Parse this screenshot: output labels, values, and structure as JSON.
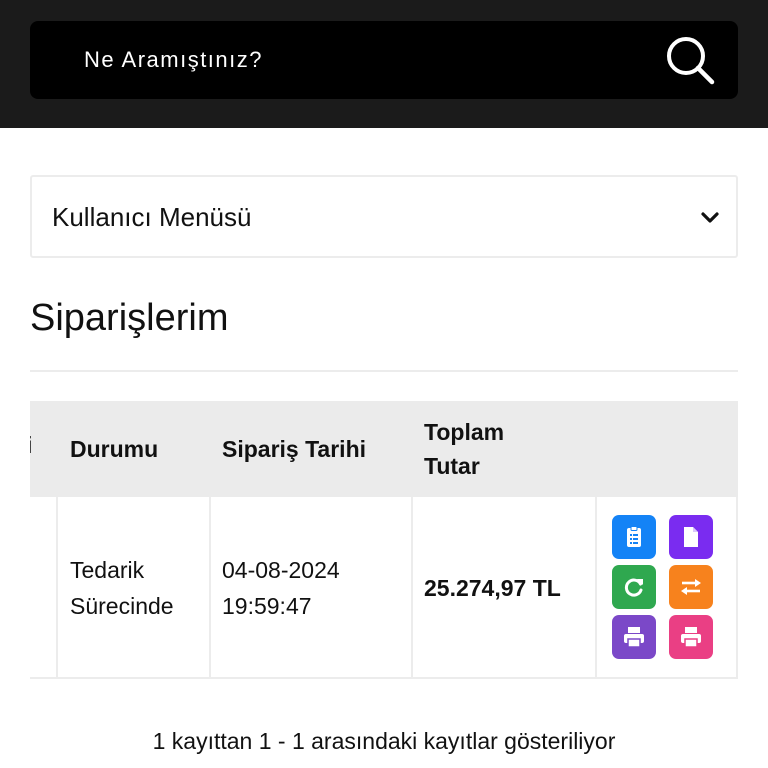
{
  "search": {
    "placeholder": "Ne Aramıştınız?"
  },
  "user_menu": {
    "label": "Kullanıcı Menüsü"
  },
  "page": {
    "title": "Siparişlerim"
  },
  "table": {
    "partial_column": "i",
    "headers": {
      "status": "Durumu",
      "date": "Sipariş Tarihi",
      "total_line1": "Toplam",
      "total_line2": "Tutar"
    },
    "rows": [
      {
        "status_line1": "Tedarik",
        "status_line2": "Sürecinde",
        "date_line1": "04-08-2024",
        "date_line2": "19:59:47",
        "total": "25.274,97 TL"
      }
    ],
    "actions": [
      {
        "name": "order-detail-button",
        "icon": "clipboard-list-icon",
        "color": "#1483f6"
      },
      {
        "name": "invoice-button",
        "icon": "document-icon",
        "color": "#7a2cf0"
      },
      {
        "name": "refund-button",
        "icon": "rotate-icon",
        "color": "#2fa84f"
      },
      {
        "name": "exchange-button",
        "icon": "arrows-exchange-icon",
        "color": "#f7821d"
      },
      {
        "name": "print-button",
        "icon": "printer-icon",
        "color": "#7b48c8"
      },
      {
        "name": "print-alt-button",
        "icon": "printer-icon",
        "color": "#ea3f84"
      }
    ]
  },
  "footer": {
    "info": "1 kayıttan 1 - 1 arasındaki kayıtlar gösteriliyor"
  }
}
